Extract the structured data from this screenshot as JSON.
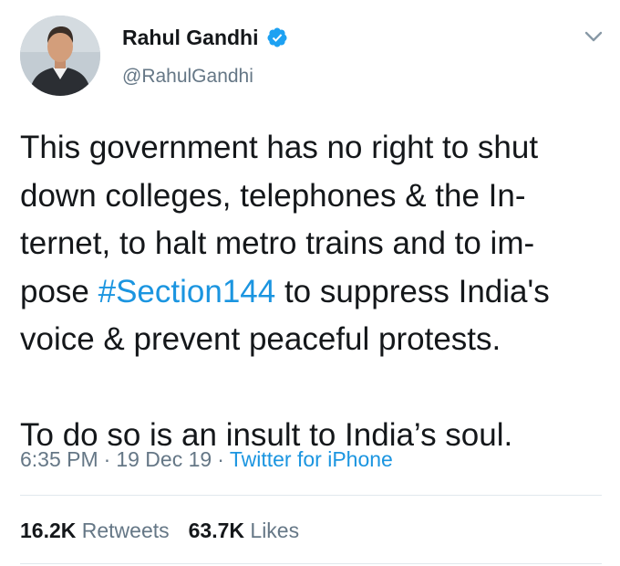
{
  "colors": {
    "text": "#14171a",
    "secondary": "#657786",
    "link": "#1b95e0",
    "verified": "#1da1f2",
    "divider": "#e1e8ed"
  },
  "user": {
    "display_name": "Rahul Gandhi",
    "handle": "@RahulGandhi",
    "verified": true,
    "verified_icon": "verified-badge-icon",
    "avatar_icon": "profile-photo"
  },
  "menu": {
    "icon": "chevron-down-icon"
  },
  "tweet": {
    "lines": [
      {
        "before": "This government has no right to shut"
      },
      {
        "before": "down colleges, telephones & the In-"
      },
      {
        "before": "ternet, to halt metro trains and to im-"
      },
      {
        "before": "pose ",
        "hashtag": "#Section144",
        "after": " to suppress India's"
      },
      {
        "before": "voice & prevent peaceful protests."
      },
      {
        "before": "To do so is an insult to India’s soul."
      }
    ]
  },
  "meta": {
    "time": "6:35 PM",
    "separator": "·",
    "date": "19 Dec 19",
    "source": "Twitter for iPhone"
  },
  "stats": {
    "retweets_count": "16.2K",
    "retweets_label": "Retweets",
    "likes_count": "63.7K",
    "likes_label": "Likes"
  }
}
